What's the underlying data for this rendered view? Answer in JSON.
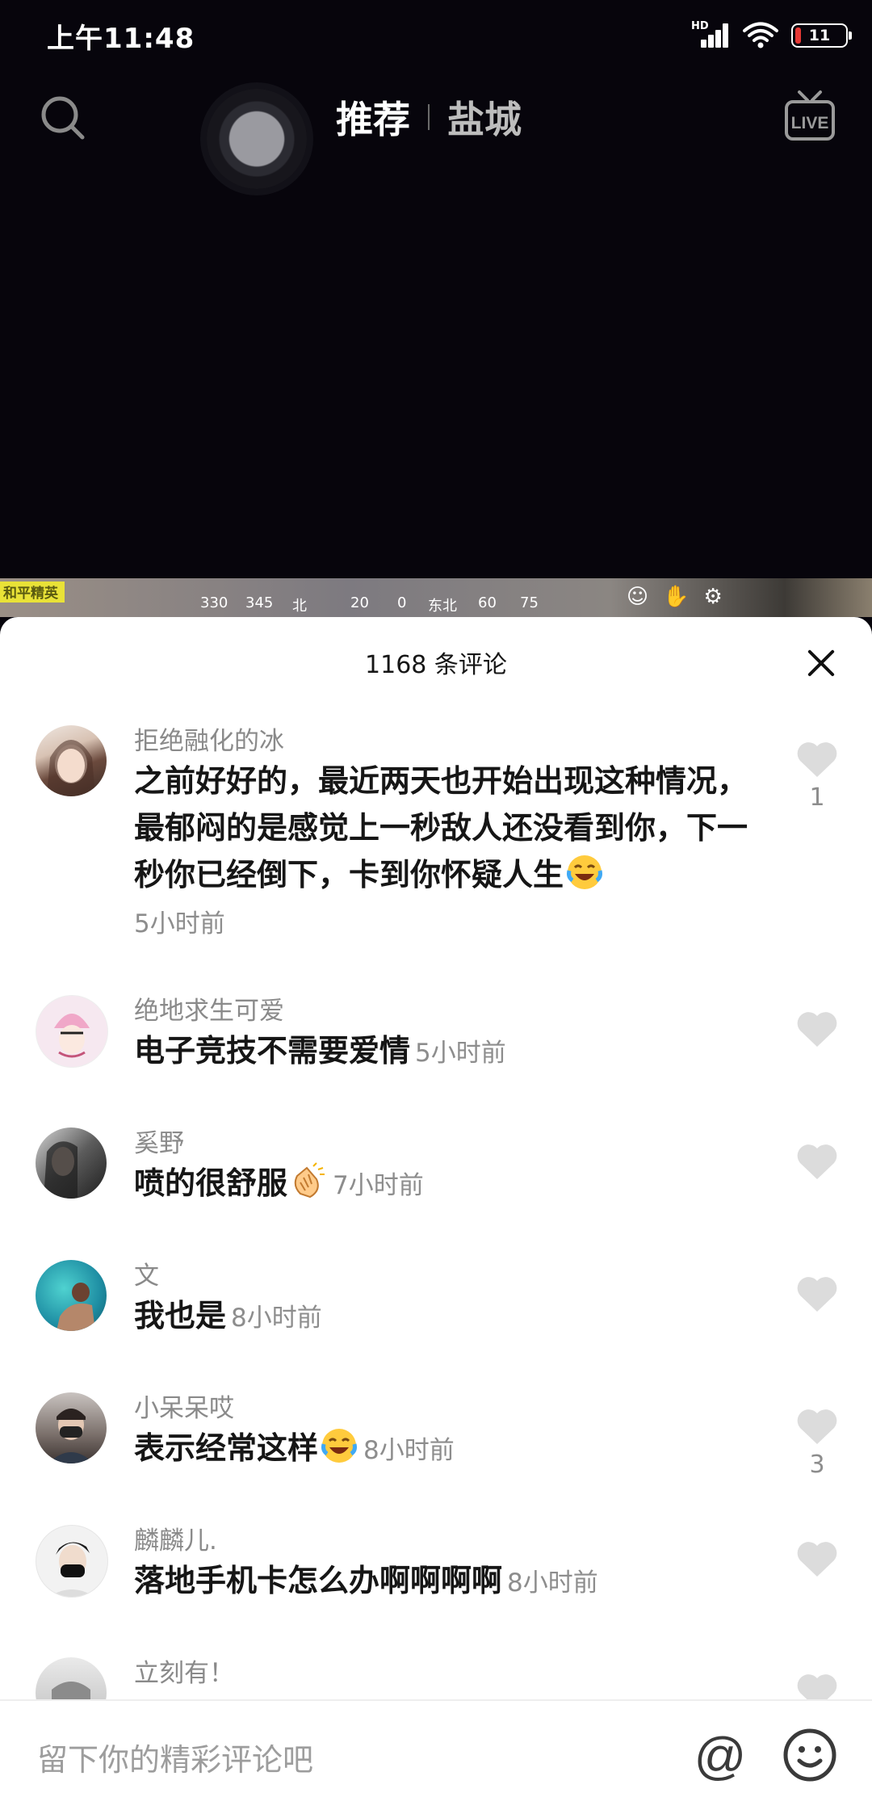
{
  "status_bar": {
    "time": "上午11:48",
    "signal_label": "HD",
    "battery_level": "11"
  },
  "top_nav": {
    "tabs": [
      "推荐",
      "盐城"
    ],
    "active_tab": "推荐"
  },
  "video_hud": {
    "badge": "和平精英",
    "compass": [
      "330",
      "345",
      "北",
      "20",
      "0",
      "东北",
      "60",
      "75"
    ]
  },
  "comments_panel": {
    "count_label": "1168 条评论",
    "comments": [
      {
        "username": "拒绝融化的冰",
        "text": "之前好好的，最近两天也开始出现这种情况，最郁闷的是感觉上一秒敌人还没看到你，下一秒你已经倒下，卡到你怀疑人生",
        "emoji": "laugh-cry-emoji",
        "time": "5小时前",
        "likes": "1"
      },
      {
        "username": "绝地求生可爱",
        "text": "电子竞技不需要爱情",
        "time": "5小时前",
        "likes": ""
      },
      {
        "username": "奚野",
        "text": "喷的很舒服",
        "emoji": "clapping-hands-emoji",
        "time": "7小时前",
        "likes": ""
      },
      {
        "username": "文",
        "text": "我也是",
        "time": "8小时前",
        "likes": ""
      },
      {
        "username": "小呆呆哎",
        "text": "表示经常这样",
        "emoji": "laugh-cry-emoji",
        "time": "8小时前",
        "likes": "3"
      },
      {
        "username": "麟麟儿.",
        "text": "落地手机卡怎么办啊啊啊啊",
        "time": "8小时前",
        "likes": ""
      },
      {
        "username": "立刻有！",
        "text": "",
        "time": "",
        "likes": ""
      }
    ]
  },
  "input_bar": {
    "placeholder": "留下你的精彩评论吧"
  },
  "colors": {
    "video_bg": "#07050c",
    "sheet_bg": "#ffffff",
    "muted_text": "#8d8d8d",
    "like_icon": "#dcdcdc"
  }
}
